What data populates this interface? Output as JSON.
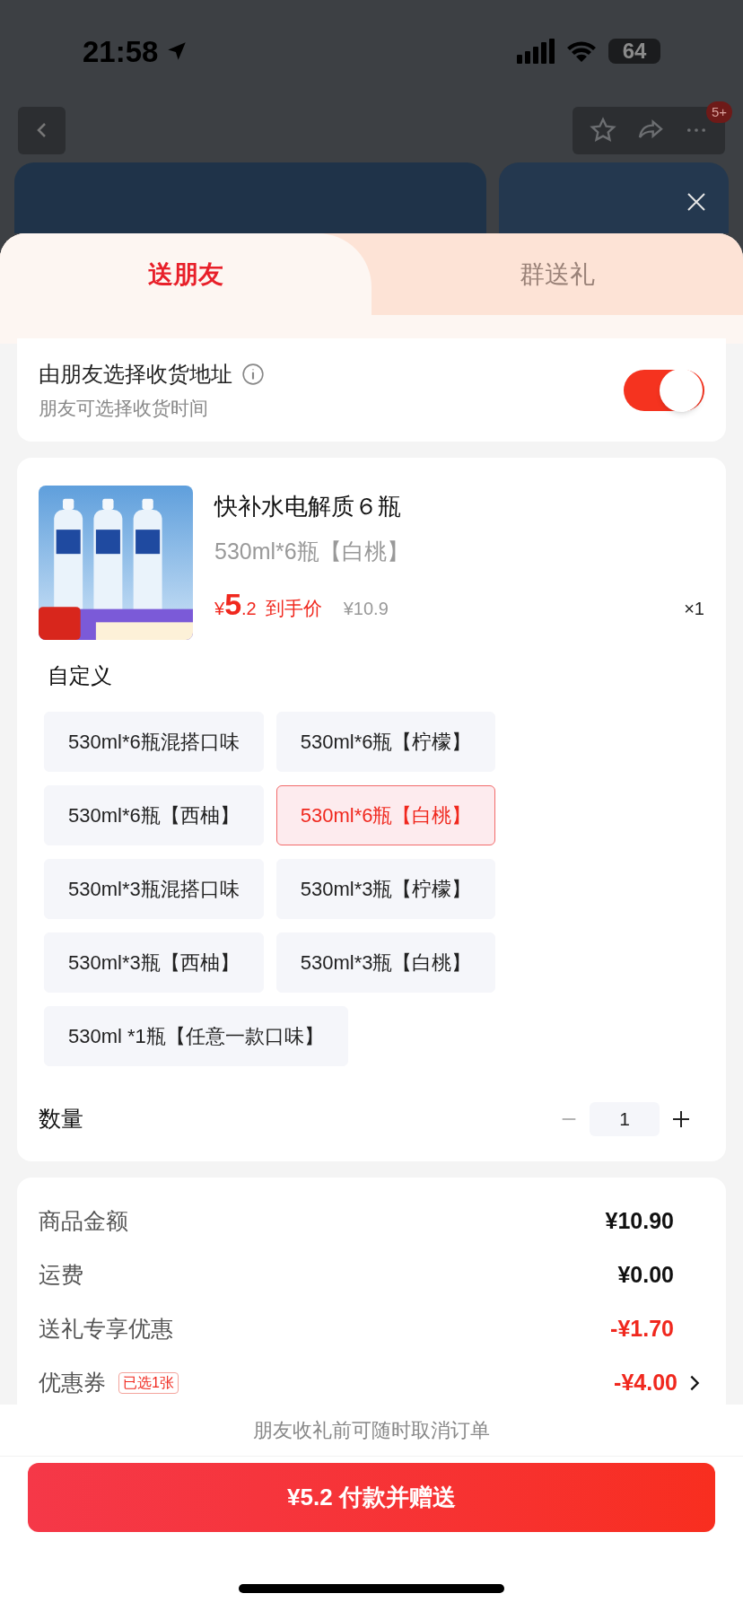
{
  "status_bar": {
    "time": "21:58",
    "battery": "64"
  },
  "nav": {
    "badge": "5+"
  },
  "tabs": [
    {
      "label": "送朋友",
      "selected": true
    },
    {
      "label": "群送礼",
      "selected": false
    }
  ],
  "address_toggle": {
    "title": "由朋友选择收货地址",
    "subtitle": "朋友可选择收货时间",
    "on": true
  },
  "product": {
    "name": "快补水电解质６瓶",
    "spec": "530ml*6瓶【白桃】",
    "currency": "¥",
    "price_int": "5",
    "price_dec": ".2",
    "price_label": "到手价",
    "original_price": "¥10.9",
    "quantity": "×1"
  },
  "options_title": "自定义",
  "options": [
    {
      "label": "530ml*6瓶混搭口味",
      "selected": false
    },
    {
      "label": "530ml*6瓶【柠檬】",
      "selected": false
    },
    {
      "label": "530ml*6瓶【西柚】",
      "selected": false
    },
    {
      "label": "530ml*6瓶【白桃】",
      "selected": true
    },
    {
      "label": "530ml*3瓶混搭口味",
      "selected": false
    },
    {
      "label": "530ml*3瓶【柠檬】",
      "selected": false
    },
    {
      "label": "530ml*3瓶【西柚】",
      "selected": false
    },
    {
      "label": "530ml*3瓶【白桃】",
      "selected": false
    },
    {
      "label": "530ml *1瓶【任意一款口味】",
      "selected": false
    }
  ],
  "quantity": {
    "label": "数量",
    "value": "1"
  },
  "summary": [
    {
      "label": "商品金额",
      "value": "¥10.90",
      "kind": "normal"
    },
    {
      "label": "运费",
      "value": "¥0.00",
      "kind": "normal"
    },
    {
      "label": "送礼专享优惠",
      "value": "-¥1.70",
      "kind": "discount"
    },
    {
      "label": "优惠券",
      "tag": "已选1张",
      "value": "-¥4.00",
      "kind": "coupon"
    }
  ],
  "footer_note": "朋友收礼前可随时取消订单",
  "pay_button": "¥5.2 付款并赠送"
}
